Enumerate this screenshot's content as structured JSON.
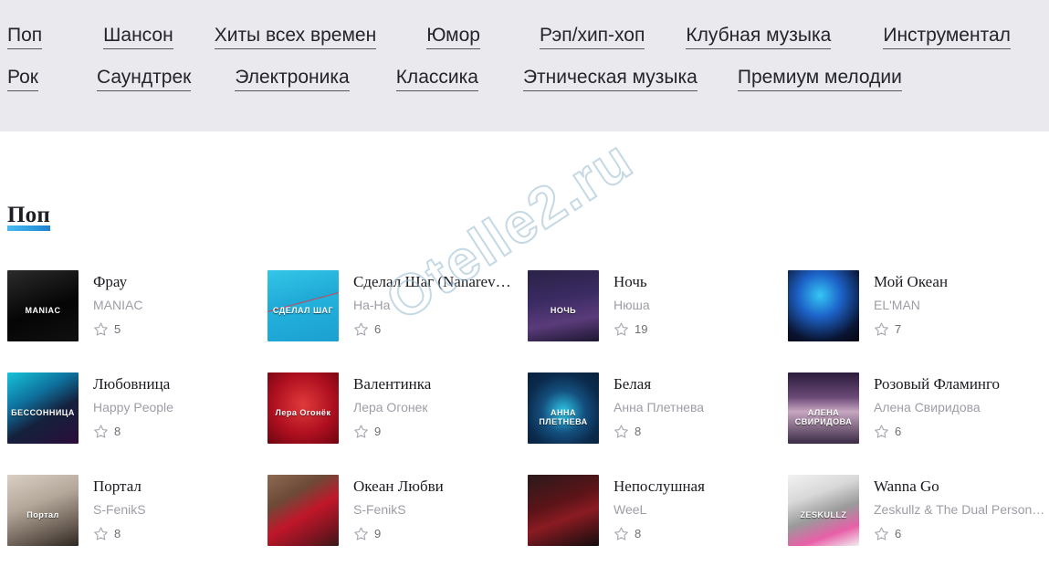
{
  "nav": {
    "row1": [
      {
        "label": "Поп"
      },
      {
        "label": "Шансон"
      },
      {
        "label": "Хиты всех времен"
      },
      {
        "label": "Юмор"
      },
      {
        "label": "Рэп/хип-хоп"
      },
      {
        "label": "Клубная музыка"
      },
      {
        "label": "Инструментал"
      }
    ],
    "row2": [
      {
        "label": "Рок"
      },
      {
        "label": "Саундтрек"
      },
      {
        "label": "Электроника"
      },
      {
        "label": "Классика"
      },
      {
        "label": "Этническая музыка"
      },
      {
        "label": "Премиум мелодии"
      }
    ]
  },
  "section": {
    "title": "Поп",
    "accent_color": "#2f9fe0"
  },
  "watermark": {
    "text": "Otelle2.ru"
  },
  "icons": {
    "star": "star-outline-icon"
  },
  "tracks": [
    {
      "title": "Фрау",
      "artist": "MANIAC",
      "rating": "5",
      "cover_label": "MANIAC",
      "cover_bg": "linear-gradient(160deg,#2b2b2b 0%,#050505 55%,#101010 100%)"
    },
    {
      "title": "Сделал Шаг (Nanarev…",
      "artist": "На-На",
      "rating": "6",
      "cover_label": "СДЕЛАЛ ШАГ",
      "cover_bg": "linear-gradient(165deg,#34c6e8 0%,#1fa9d6 45%,#d83a4a 46%,#22b2dc 47%,#1c9fd0 100%)"
    },
    {
      "title": "Ночь",
      "artist": "Нюша",
      "rating": "19",
      "cover_label": "НОЧЬ",
      "cover_bg": "linear-gradient(170deg,#2a2246 0%,#3b2b63 40%,#5a3b7a 70%,#1d1730 100%)"
    },
    {
      "title": "Мой Океан",
      "artist": "EL'MAN",
      "rating": "7",
      "cover_label": "",
      "cover_bg": "radial-gradient(circle at 45% 35%, #35c7f5 0%, #1d63c9 35%, #0a1533 75%, #05050f 100%)"
    },
    {
      "title": "Любовница",
      "artist": "Happy People",
      "rating": "8",
      "cover_label": "БЕССОННИЦА",
      "cover_bg": "linear-gradient(150deg,#16c4d8 0%,#0e6f9c 35%,#14213d 60%,#2b0d3a 100%)"
    },
    {
      "title": "Валентинка",
      "artist": "Лера Огонек",
      "rating": "9",
      "cover_label": "Лера Огонёк",
      "cover_bg": "radial-gradient(circle at 50% 45%, #e03a3a 0%, #b01020 55%, #6d0510 100%)"
    },
    {
      "title": "Белая",
      "artist": "Анна Плетнева",
      "rating": "8",
      "cover_label": "АННА ПЛЕТНЕВА",
      "cover_bg": "radial-gradient(circle at 50% 55%, #2ec8e8 0%, #14507f 40%, #0b2b4d 70%, #07203c 100%)"
    },
    {
      "title": "Розовый Фламинго",
      "artist": "Алена Свиридова",
      "rating": "6",
      "cover_label": "АЛЕНА СВИРИДОВА",
      "cover_bg": "linear-gradient(180deg,#2b1c3c 0%,#6b4a78 35%,#c7a6c0 55%,#3a2a44 100%)"
    },
    {
      "title": "Портал",
      "artist": "S-FenikS",
      "rating": "8",
      "cover_label": "Портал",
      "cover_bg": "linear-gradient(160deg,#d9cfc2 0%,#b3a79a 40%,#6b5f55 75%,#2e2722 100%)"
    },
    {
      "title": "Океан Любви",
      "artist": "S-FenikS",
      "rating": "9",
      "cover_label": "",
      "cover_bg": "linear-gradient(150deg,#8c6a52 0%,#6d4a38 30%,#c0172a 55%,#7d1420 80%,#3a1a18 100%)"
    },
    {
      "title": "Непослушная",
      "artist": "WeeL",
      "rating": "8",
      "cover_label": "",
      "cover_bg": "linear-gradient(160deg,#2a1a1c 0%,#5c1418 40%,#8a1b22 60%,#140c0e 100%)"
    },
    {
      "title": "Wanna Go",
      "artist": "Zeskullz & The Dual Person…",
      "rating": "6",
      "cover_label": "ZESKULLZ",
      "cover_bg": "linear-gradient(160deg,#f2f2f2 0%,#d8d8d8 30%,#9a9a9a 55%,#e85fa8 78%,#f0f0f0 100%)"
    }
  ]
}
